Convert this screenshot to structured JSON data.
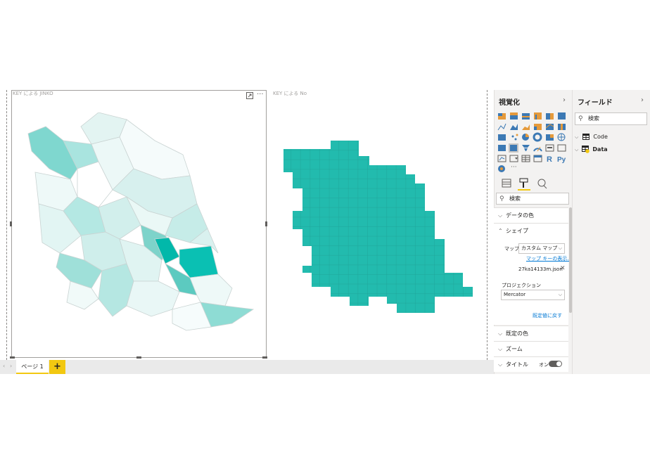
{
  "canvas": {
    "visual1": {
      "title": "KEY による JINKO"
    },
    "visual2": {
      "title": "KEY による No"
    },
    "focus_icon": "focus-mode-icon",
    "more_icon": "more-options-icon"
  },
  "page_tabs": {
    "tabs": [
      {
        "label": "ページ 1"
      }
    ],
    "add_label": "+"
  },
  "visualizations": {
    "title": "視覚化",
    "collapse_glyph": "›",
    "more_glyph": "···",
    "search_placeholder": "検索",
    "sections": {
      "data_colors": "データの色",
      "shape": "シェイプ",
      "default_colors": "既定の色",
      "zoom": "ズーム",
      "title": "タイトル"
    },
    "shape": {
      "map_label": "マップ",
      "map_value": "カスタム マップ",
      "map_keys_link": "マップ キーの表示...",
      "file_name": "27ka14133m.json",
      "projection_label": "プロジェクション",
      "projection_value": "Mercator",
      "reset_link": "既定値に戻す"
    },
    "title_toggle": "オン",
    "colors": {
      "accent": "#f2c811",
      "teal": "#01b8aa",
      "link": "#0078d4"
    }
  },
  "fields": {
    "title": "フィールド",
    "collapse_glyph": "›",
    "search_placeholder": "検索",
    "tables": [
      {
        "name": "Code"
      },
      {
        "name": "Data"
      }
    ]
  }
}
